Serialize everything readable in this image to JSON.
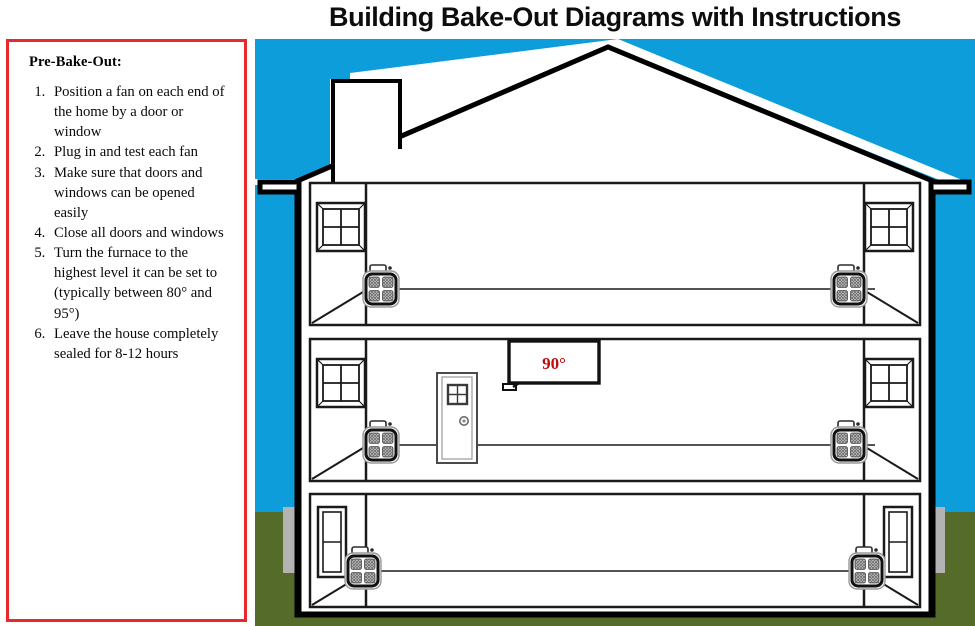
{
  "header": {
    "title": "Building Bake-Out Diagrams with Instructions"
  },
  "panel": {
    "heading": "Pre-Bake-Out:",
    "steps": [
      "Position a fan on each end of the home by a door or window",
      "Plug in and test each fan",
      "Make sure that doors and windows can be opened easily",
      "Close all doors and windows",
      "Turn the furnace to the highest level it can be set to (typically between 80° and 95°)",
      "Leave the house completely sealed for 8-12 hours"
    ],
    "border_color": "#e8292b"
  },
  "diagram": {
    "label": "house-cross-section",
    "thermostat_reading": "90°",
    "thermostat_text_color": "#c00b0b",
    "sky_color": "#0e9ddb",
    "ground_color": "#556b2a",
    "wall_color": "#ffffff",
    "outline_color": "#000000",
    "foundation_color": "#b3b3b3",
    "floors": [
      {
        "name": "upper-floor",
        "fans": 2,
        "windows": 2
      },
      {
        "name": "main-floor",
        "fans": 2,
        "windows": 2,
        "doors": 1,
        "thermostat": 1
      },
      {
        "name": "basement-floor",
        "fans": 2,
        "windows": 2
      }
    ],
    "fan_count": 6,
    "window_count": 6,
    "door_count": 1
  }
}
